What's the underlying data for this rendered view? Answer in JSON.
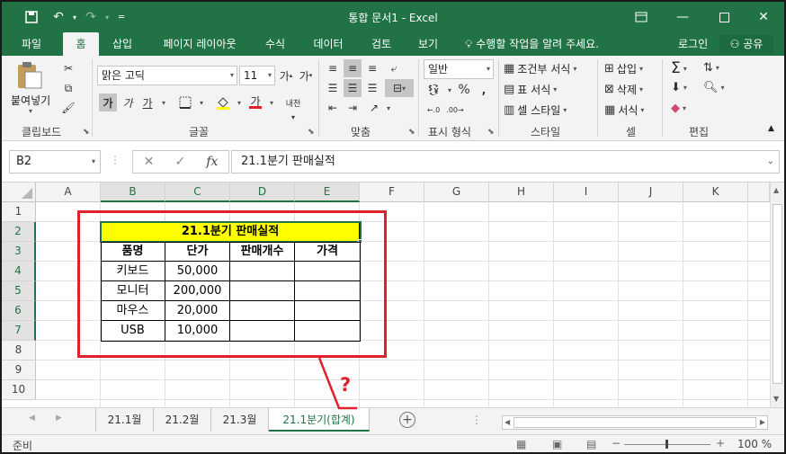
{
  "window": {
    "title": "통합 문서1 - Excel"
  },
  "ribbon_tabs": [
    "파일",
    "홈",
    "삽입",
    "페이지 레이아웃",
    "수식",
    "데이터",
    "검토",
    "보기"
  ],
  "tell_me": "수행할 작업을 알려 주세요.",
  "account": {
    "login": "로그인",
    "share": "공유"
  },
  "ribbon": {
    "clipboard": {
      "paste": "붙여넣기",
      "group": "클립보드"
    },
    "font": {
      "name": "맑은 고딕",
      "size": "11",
      "bold": "가",
      "italic": "가",
      "underline": "가",
      "group": "글꼴",
      "color_label": "가",
      "phonetic": "내천"
    },
    "alignment": {
      "group": "맞춤"
    },
    "number": {
      "format": "일반",
      "group": "표시 형식",
      "percent": "%"
    },
    "styles": {
      "conditional": "조건부 서식",
      "table": "표 서식",
      "cell_styles": "셀 스타일",
      "group": "스타일"
    },
    "cells": {
      "insert": "삽입",
      "delete": "삭제",
      "format": "서식",
      "group": "셀"
    },
    "editing": {
      "group": "편집"
    }
  },
  "formula_bar": {
    "name_box": "B2",
    "formula": "21.1분기 판매실적"
  },
  "columns": [
    "A",
    "B",
    "C",
    "D",
    "E",
    "F",
    "G",
    "H",
    "I",
    "J",
    "K"
  ],
  "rows": [
    "1",
    "2",
    "3",
    "4",
    "5",
    "6",
    "7",
    "8",
    "9",
    "10"
  ],
  "sheet": {
    "title": "21.1분기 판매실적",
    "headers": [
      "품명",
      "단가",
      "판매개수",
      "가격"
    ],
    "items": [
      {
        "name": "키보드",
        "price": "50,000"
      },
      {
        "name": "모니터",
        "price": "200,000"
      },
      {
        "name": "마우스",
        "price": "20,000"
      },
      {
        "name": "USB",
        "price": "10,000"
      }
    ],
    "title_fill": "#ffff00"
  },
  "sheet_tabs": [
    "21.1월",
    "21.2월",
    "21.3월",
    "21.1분기(합계)"
  ],
  "active_sheet_tab": "21.1분기(합계)",
  "status": {
    "ready": "준비",
    "zoom": "100 %"
  },
  "annotation": {
    "mark": "?"
  },
  "colors": {
    "excel_green": "#217346",
    "annotation_red": "#e0202a"
  }
}
